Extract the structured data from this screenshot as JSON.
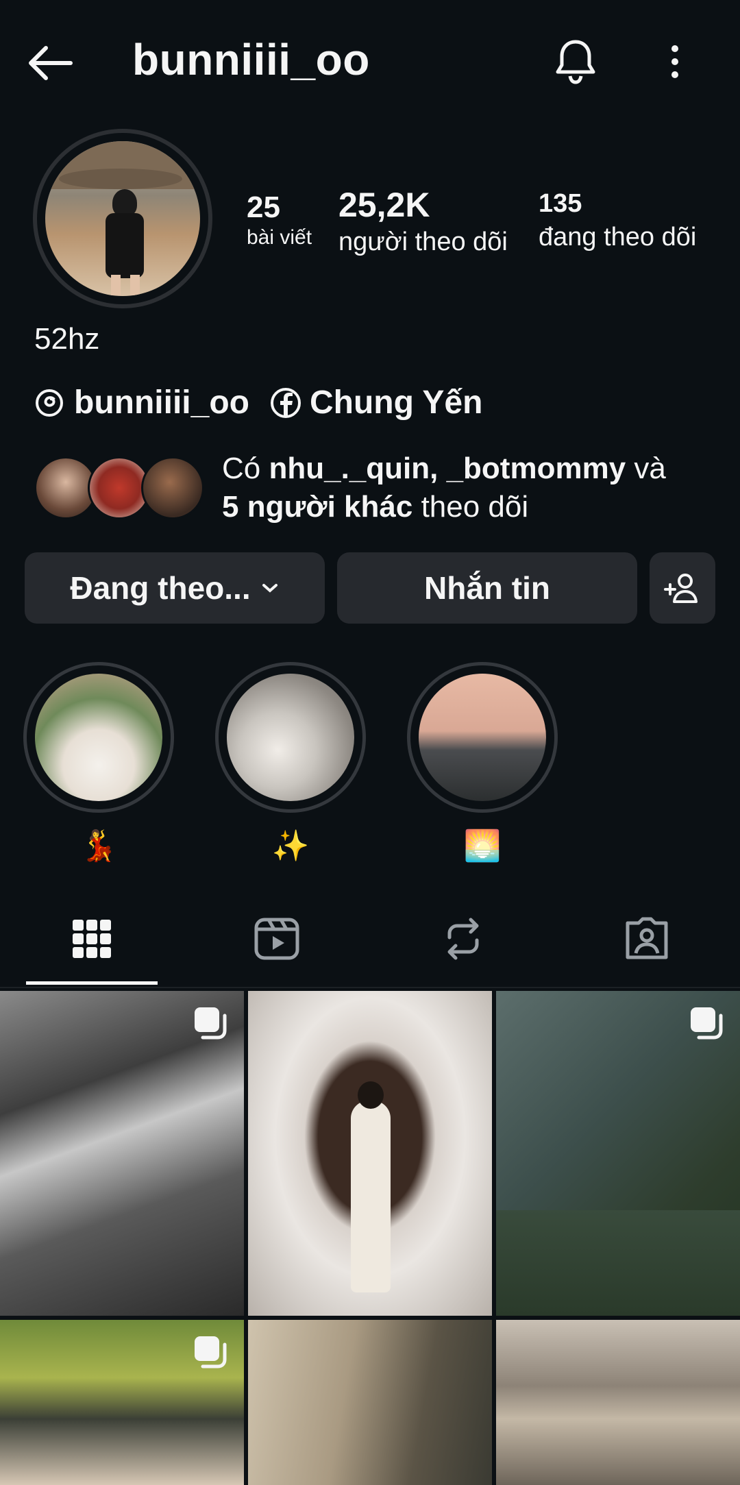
{
  "header": {
    "username": "bunniiii_oo"
  },
  "stats": [
    {
      "value": "25",
      "label": "bài viết"
    },
    {
      "value": "25,2K",
      "label": "người theo dõi"
    },
    {
      "value": "135",
      "label": "đang theo dõi"
    }
  ],
  "bio": "52hz",
  "links": {
    "threads": "bunniiii_oo",
    "facebook": "Chung Yến"
  },
  "followed_by": {
    "prefix": "Có ",
    "names": "nhu_._quin, _botmommy",
    "middle": " và",
    "others": "5 người khác",
    "suffix": " theo dõi"
  },
  "buttons": {
    "following": "Đang theo...",
    "message": "Nhắn tin"
  },
  "highlights": [
    {
      "label": "💃"
    },
    {
      "label": "✨"
    },
    {
      "label": "🌅"
    }
  ],
  "colors": {
    "background": "#0b1014",
    "button": "#26292e",
    "text": "#f5f5f5"
  }
}
